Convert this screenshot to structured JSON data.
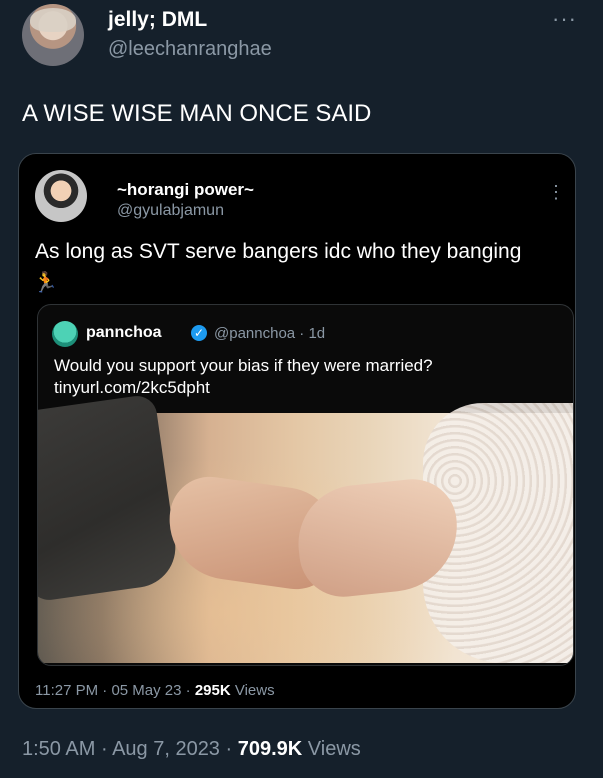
{
  "tweet": {
    "display_name": "jelly; DML",
    "handle": "@leechanranghae",
    "text": "A WISE WISE MAN ONCE SAID",
    "time": "1:50 AM",
    "date": "Aug 7, 2023",
    "views_count": "709.9K",
    "views_label": "Views"
  },
  "quoted": {
    "display_name": "~horangi power~",
    "handle": "@gyulabjamun",
    "text": "As long as SVT serve bangers idc who they banging",
    "emoji": "🏃",
    "time": "11:27 PM",
    "date": "05 May 23",
    "views_count": "295K",
    "views_label": "Views"
  },
  "inner": {
    "display_name": "pannchoa",
    "handle": "@pannchoa · 1d",
    "text_line1": "Would you support your bias if they were married?",
    "text_line2": "tinyurl.com/2kc5dpht"
  },
  "icons": {
    "more": "more-horizontal-icon",
    "more_vertical": "more-vertical-icon",
    "verified": "verified-badge-icon"
  },
  "colors": {
    "background": "#15202b",
    "quote_background": "#000000",
    "secondary_text": "#8b98a5",
    "verified": "#1d9bf0"
  }
}
